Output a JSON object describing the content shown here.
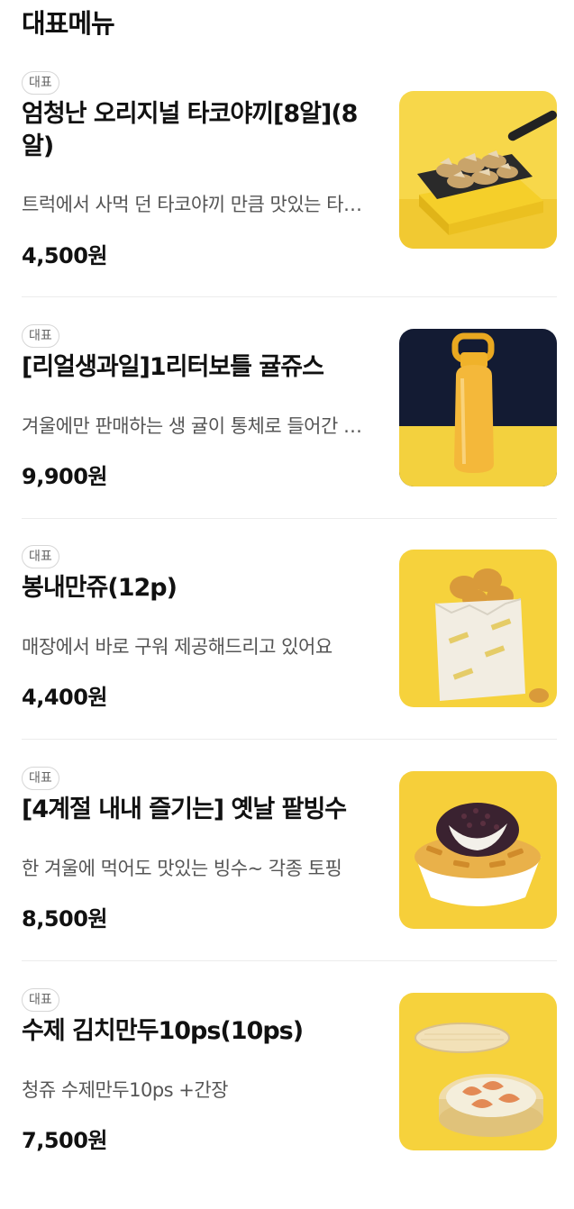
{
  "section": {
    "title": "대표메뉴"
  },
  "menu_items": [
    {
      "badge": "대표",
      "name": "엄청난 오리지널 타코야끼[8알](8알)",
      "description": "트럭에서 사먹 던 타코야끼 만큼 맛있는 타코야끼",
      "price": "4,500원",
      "image_icon": "takoyaki-photo"
    },
    {
      "badge": "대표",
      "name": "[리얼생과일]1리터보틀 귤쥬스",
      "description": "겨울에만 판매하는 생 귤이 통체로 들어간 쥬스",
      "price": "9,900원",
      "image_icon": "juice-bottle-photo"
    },
    {
      "badge": "대표",
      "name": "봉내만쥬(12p)",
      "description": "매장에서 바로 구워 제공해드리고 있어요",
      "price": "4,400원",
      "image_icon": "manju-bag-photo"
    },
    {
      "badge": "대표",
      "name": "[4계절 내내 즐기는] 옛날 팥빙수",
      "description": "한 겨울에 먹어도 맛있는 빙수~ 각종 토핑",
      "price": "8,500원",
      "image_icon": "patbingsu-photo"
    },
    {
      "badge": "대표",
      "name": "수제 김치만두10ps(10ps)",
      "description": "청쥬 수제만두10ps +간장",
      "price": "7,500원",
      "image_icon": "dumpling-steamer-photo"
    }
  ],
  "colors": {
    "background": "#ffffff",
    "thumb_yellow": "#f6d23c",
    "thumb_navy": "#131b33"
  }
}
